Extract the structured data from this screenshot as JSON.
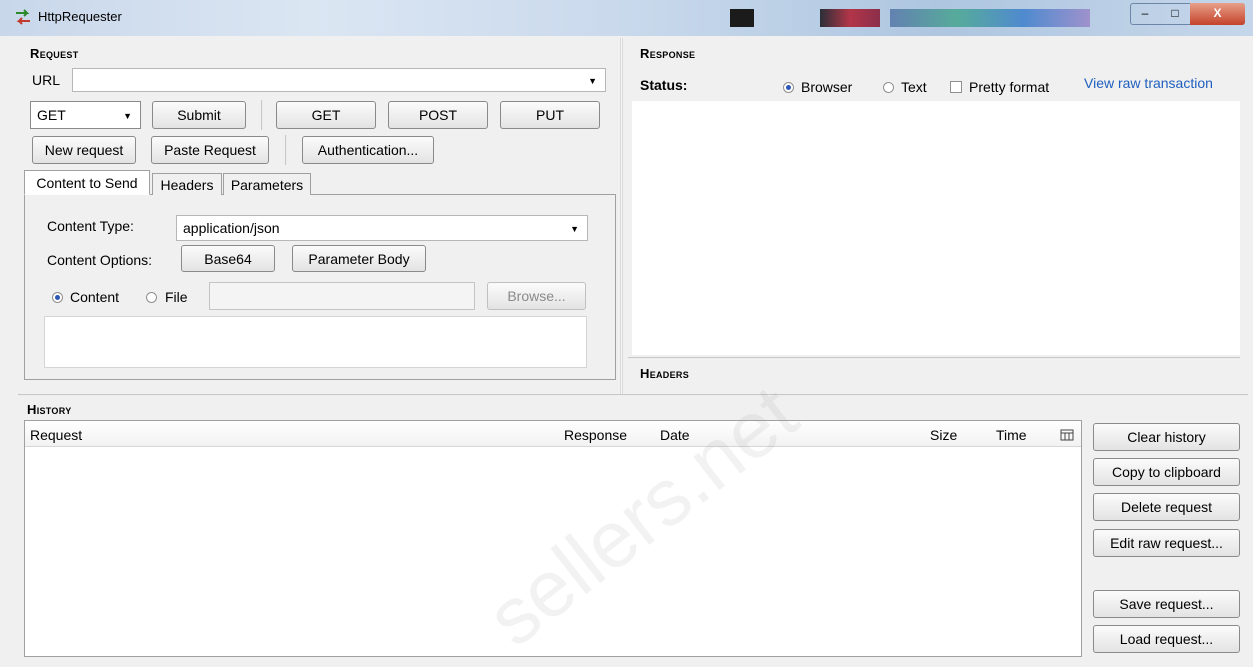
{
  "window": {
    "title": "HttpRequester",
    "minimize_label": "–",
    "maximize_label": "□",
    "close_label": "X",
    "swatches": [
      "#2a2f38",
      "#b23548",
      "#8b2f4b",
      "#5575a8",
      "#47a68e",
      "#3d7fcc",
      "#9a87c8"
    ]
  },
  "request": {
    "section_title": "Request",
    "url_label": "URL",
    "url_value": "",
    "method_value": "GET",
    "submit_label": "Submit",
    "quick_get_label": "GET",
    "quick_post_label": "POST",
    "quick_put_label": "PUT",
    "new_request_label": "New request",
    "paste_request_label": "Paste Request",
    "authentication_label": "Authentication...",
    "tabs": [
      "Content to Send",
      "Headers",
      "Parameters"
    ],
    "content_type_label": "Content Type:",
    "content_type_value": "application/json",
    "content_options_label": "Content Options:",
    "base64_label": "Base64",
    "parameter_body_label": "Parameter Body",
    "content_radio_label": "Content",
    "file_radio_label": "File",
    "file_value": "",
    "browse_label": "Browse..."
  },
  "response": {
    "section_title": "Response",
    "status_label": "Status:",
    "browser_label": "Browser",
    "text_label": "Text",
    "pretty_label": "Pretty format",
    "raw_link": "View raw transaction",
    "headers_title": "Headers"
  },
  "history": {
    "section_title": "History",
    "columns": [
      "Request",
      "Response",
      "Date",
      "Size",
      "Time"
    ],
    "buttons": {
      "clear": "Clear history",
      "copy": "Copy to clipboard",
      "delete": "Delete request",
      "edit": "Edit raw request...",
      "save": "Save request...",
      "load": "Load request..."
    }
  },
  "watermark": "sellers.net"
}
